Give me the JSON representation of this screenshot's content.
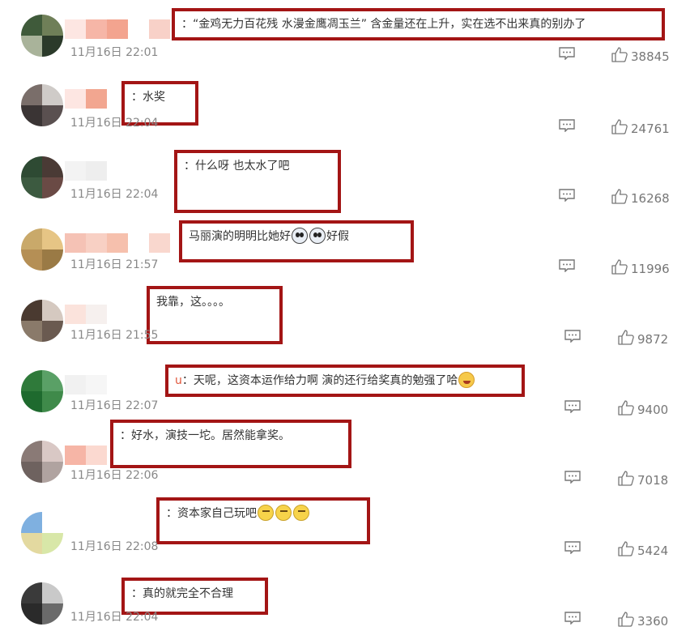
{
  "comments": [
    {
      "text": "：“金鸡无力百花残 水漫金鹰凋玉兰” 含金量还在上升，实在选不出来真的别办了",
      "time": "11月16日 22:01",
      "likes": "38845",
      "name_fragment": "",
      "avatar_colors": [
        "#3f5a3a",
        "#6f7f58",
        "#a9b39a",
        "#2b3a2a"
      ],
      "name_colors": [
        "#fde6e2",
        "#f6b6a7",
        "#f3a48f",
        "#ffffff",
        "#f8d1c8"
      ]
    },
    {
      "text": "：水奖",
      "time": "11月16日 22:04",
      "likes": "24761",
      "name_fragment": "",
      "avatar_colors": [
        "#7a6e6a",
        "#cfcbc8",
        "#3a3434",
        "#5a5050"
      ],
      "name_colors": [
        "#fde6e2",
        "#f2a690",
        "#ffffff"
      ]
    },
    {
      "text": "：什么呀 也太水了吧",
      "time": "11月16日 22:04",
      "likes": "16268",
      "name_fragment": "",
      "avatar_colors": [
        "#2e4a33",
        "#4a3a35",
        "#3c5a40",
        "#6a4a45"
      ],
      "name_colors": [
        "#f3f3f3",
        "#eeeeee",
        "#ffffff"
      ]
    },
    {
      "text": "马丽演的明明比她好",
      "text2": "好假",
      "time": "11月16日 21:57",
      "likes": "11996",
      "name_fragment": "",
      "avatar_colors": [
        "#c9a96a",
        "#e6c585",
        "#b58f55",
        "#9a7a45"
      ],
      "name_colors": [
        "#f5c2b5",
        "#f8d0c4",
        "#f6c0ad",
        "#ffffff",
        "#f9d7ce"
      ]
    },
    {
      "text": "我靠，这。。。。",
      "time": "11月16日 21:55",
      "likes": "9872",
      "name_fragment": "",
      "avatar_colors": [
        "#4a3a30",
        "#d5c9c0",
        "#8a7a6a",
        "#6a5a50"
      ],
      "name_colors": [
        "#fbe3dc",
        "#f6f0ee",
        "#ffffff"
      ]
    },
    {
      "text": "：天呢，这资本运作给力啊 演的还行给奖真的勉强了哈",
      "time": "11月16日 22:07",
      "likes": "9400",
      "name_fragment": "u",
      "avatar_colors": [
        "#2f7a3a",
        "#5aa066",
        "#1e6a2e",
        "#3f8a4a"
      ],
      "name_colors": [
        "#f1f1f1",
        "#f6f6f6",
        "#ffffff"
      ]
    },
    {
      "text": "：好水，演技一坨。居然能拿奖。",
      "time": "11月16日 22:06",
      "likes": "7018",
      "name_fragment": "",
      "avatar_colors": [
        "#8a7a76",
        "#d9c8c5",
        "#6e625f",
        "#b0a3a0"
      ],
      "name_colors": [
        "#f6b5a6",
        "#fbd9d0",
        "#ffffff"
      ]
    },
    {
      "text": "：资本家自己玩吧",
      "time": "11月16日 22:08",
      "likes": "5424",
      "name_fragment": "",
      "avatar_colors": [
        "#7fb0e0",
        "#ffffff",
        "#e3d9a0",
        "#d8e7a8"
      ],
      "name_colors": [
        "#ffffff",
        "#ffffff",
        "#ffffff"
      ]
    },
    {
      "text": "：真的就完全不合理",
      "time": "11月16日 22:04",
      "likes": "3360",
      "name_fragment": "",
      "avatar_colors": [
        "#3a3a3a",
        "#c9c9c9",
        "#2a2a2a",
        "#6a6a6a"
      ],
      "name_colors": [
        "#ffffff",
        "#ffffff",
        "#ffffff"
      ]
    }
  ],
  "colors": {
    "highlight_border": "#a31515",
    "meta_text": "#888888"
  },
  "icons": {
    "reply": "comment-icon",
    "like": "thumbs-up-icon"
  }
}
